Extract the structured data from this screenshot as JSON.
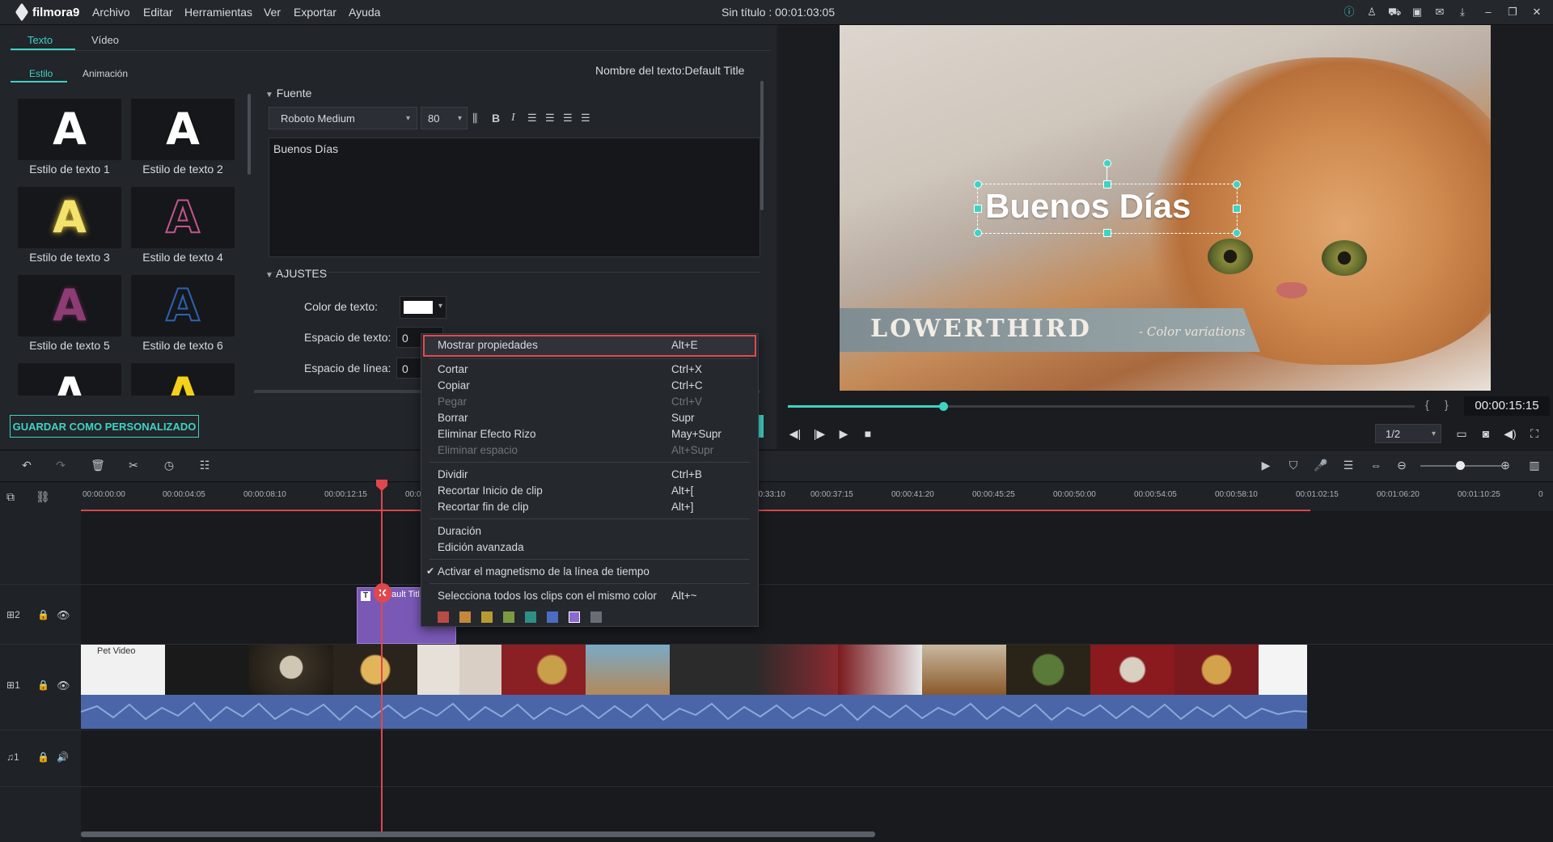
{
  "app": {
    "logo": "filmora9",
    "menu": [
      "Archivo",
      "Editar",
      "Herramientas",
      "Ver",
      "Exportar",
      "Ayuda"
    ],
    "title": "Sin título : 00:01:03:05"
  },
  "left_panel": {
    "tabs": [
      "Texto",
      "Vídeo"
    ],
    "subtabs": [
      "Estilo",
      "Animación"
    ],
    "text_name": "Nombre del texto:Default Title",
    "presets": [
      {
        "label": "Estilo de texto 1",
        "glyph": "A",
        "color": "#ffffff"
      },
      {
        "label": "Estilo de texto 2",
        "glyph": "A",
        "color": "#ffffff"
      },
      {
        "label": "Estilo de texto 3",
        "glyph": "A",
        "color": "#f3e26b"
      },
      {
        "label": "Estilo de texto 4",
        "glyph": "A",
        "color": "#c4558f"
      },
      {
        "label": "Estilo de texto 5",
        "glyph": "A",
        "color": "#8e3c74"
      },
      {
        "label": "Estilo de texto 6",
        "glyph": "A",
        "color": "#2e62b0"
      },
      {
        "label": "",
        "glyph": "A",
        "color": "#ffffff"
      },
      {
        "label": "",
        "glyph": "A",
        "color": "#f5d21a"
      }
    ],
    "font_section": "Fuente",
    "font_family": "Roboto Medium",
    "font_size": "80",
    "text_value": "Buenos Días",
    "ajustes_section": "AJUSTES",
    "color_label": "Color de texto:",
    "text_spacing_label": "Espacio de texto:",
    "text_spacing_value": "0",
    "line_spacing_label": "Espacio de línea:",
    "line_spacing_value": "0",
    "save_button": "GUARDAR COMO PERSONALIZADO"
  },
  "preview": {
    "overlay_title": "Buenos Días",
    "lowerthird": "LOWERTHIRD",
    "lowerthird_sub": "- Color variations",
    "timecode": "00:00:15:15",
    "ratio": "1/2",
    "progress": 0.25
  },
  "timeline": {
    "ticks": [
      "00:00:00:00",
      "00:00:04:05",
      "00:00:08:10",
      "00:00:12:15",
      "00:0",
      "00:33:10",
      "00:00:37:15",
      "00:00:41:20",
      "00:00:45:25",
      "00:00:50:00",
      "00:00:54:05",
      "00:00:58:10",
      "00:01:02:15",
      "00:01:06:20",
      "00:01:10:25",
      "0"
    ],
    "tracks": [
      {
        "id": "2",
        "clip_label": "ault Titl"
      },
      {
        "id": "1",
        "clip_label": "Pet Video"
      },
      {
        "id": "1",
        "type": "audio"
      }
    ]
  },
  "context_menu": {
    "items": [
      {
        "label": "Mostrar propiedades",
        "shortcut": "Alt+E",
        "disabled": false,
        "highlight": true
      },
      {
        "label": "Cortar",
        "shortcut": "Ctrl+X",
        "disabled": false
      },
      {
        "label": "Copiar",
        "shortcut": "Ctrl+C",
        "disabled": false
      },
      {
        "label": "Pegar",
        "shortcut": "Ctrl+V",
        "disabled": true
      },
      {
        "label": "Borrar",
        "shortcut": "Supr",
        "disabled": false
      },
      {
        "label": "Eliminar Efecto Rizo",
        "shortcut": "May+Supr",
        "disabled": false
      },
      {
        "label": "Eliminar espacio",
        "shortcut": "Alt+Supr",
        "disabled": true
      },
      {
        "label": "Dividir",
        "shortcut": "Ctrl+B",
        "disabled": false
      },
      {
        "label": "Recortar Inicio de clip",
        "shortcut": "Alt+[",
        "disabled": false
      },
      {
        "label": "Recortar fin de clip",
        "shortcut": "Alt+]",
        "disabled": false
      },
      {
        "label": "Duración",
        "shortcut": "",
        "disabled": false
      },
      {
        "label": "Edición avanzada",
        "shortcut": "",
        "disabled": false
      },
      {
        "label": "Activar el magnetismo de la línea de tiempo",
        "shortcut": "",
        "disabled": false,
        "checked": true
      },
      {
        "label": "Selecciona todos los clips con el mismo color",
        "shortcut": "Alt+~",
        "disabled": false
      }
    ],
    "swatches": [
      "#b84c44",
      "#c4883a",
      "#b89a32",
      "#7c9a42",
      "#2e8f86",
      "#4c6cc0",
      "#8a6ad0",
      "#6a6e74"
    ]
  },
  "colors": {
    "accent": "#3ed3c4",
    "playhead": "#e0474c",
    "title_clip": "#7a58b6",
    "highlight_border": "#e14a4e"
  }
}
